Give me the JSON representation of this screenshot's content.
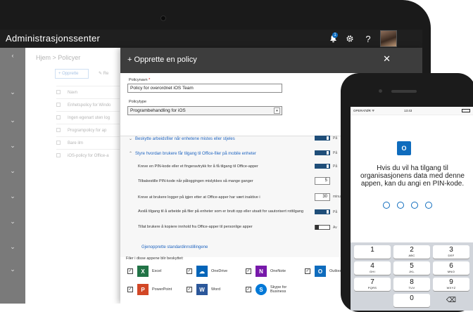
{
  "topbar": {
    "title": "Administrasjonssenter",
    "notification_count": "1",
    "icons": [
      "bell-icon",
      "gear-icon",
      "help-icon"
    ],
    "help_label": "?"
  },
  "background_page": {
    "breadcrumb": "Hjem > Policyer",
    "new_button": "+ Opprette",
    "edit_button": "✎ Re",
    "column_header": "Navn",
    "rows": [
      "Enhetspolicy for Windo",
      "Ingen egenart uten log",
      "Programpolicy for ap",
      "Bare ilm",
      "iOS-policy for Office-a"
    ]
  },
  "panel": {
    "title": "+ Opprette en policy",
    "close_label": "✕",
    "name_label": "Policynavn",
    "name_required": "*",
    "name_value": "Policy for overordnet iOS Team",
    "type_label": "Policytype",
    "type_value": "Programbehandling for iOS",
    "sections": [
      {
        "label": "Beskytte arbeidsfiler når enhetene mistes eller stjeles",
        "chevron": "⌄",
        "toggle_label": "På"
      },
      {
        "label": "Styre hvordan brukere får tilgang til Office-filer på mobile enheter",
        "chevron": "⌃",
        "toggle_label": "På"
      }
    ],
    "settings": [
      {
        "text": "Kreve en PIN-kode eller et fingeravtrykk for å få tilgang til Office-apper",
        "control": "toggle",
        "value": "På"
      },
      {
        "text": "Tilbakestille PIN-kode når påloggingen mislykkes så mange ganger",
        "control": "number",
        "value": "5"
      },
      {
        "text": "Kreve at brukere logger på igjen etter at Office-apper har vært inaktive i",
        "control": "number",
        "value": "30",
        "unit": "minut"
      },
      {
        "text": "Avslå tilgang til å arbeide på filer på enheter som er brutt opp eller utsatt for uautorisert rottilgang",
        "control": "toggle",
        "value": "På"
      },
      {
        "text": "Tillat brukere å kopiere innhold fra Office-apper til personlige apper",
        "control": "toggle-off",
        "value": "Av"
      }
    ],
    "restore_link": "Gjenopprette standardinnstillingene",
    "files_label": "Filer i disse appene blir beskyttet:",
    "apps": [
      {
        "name": "Excel",
        "letter": "X",
        "color": "#217346",
        "icon": "excel-icon"
      },
      {
        "name": "OneDrive",
        "letter": "☁",
        "color": "#0364b8",
        "icon": "onedrive-icon"
      },
      {
        "name": "OneNote",
        "letter": "N",
        "color": "#7719aa",
        "icon": "onenote-icon"
      },
      {
        "name": "Outlook",
        "letter": "O",
        "color": "#0f6cbd",
        "icon": "outlook-icon"
      },
      {
        "name": "PowerPoint",
        "letter": "P",
        "color": "#d24726",
        "icon": "powerpoint-icon"
      },
      {
        "name": "Word",
        "letter": "W",
        "color": "#2b579a",
        "icon": "word-icon"
      },
      {
        "name": "Skype for Business",
        "letter": "S",
        "color": "#0078d7",
        "icon": "skype-icon"
      }
    ],
    "check_mark": "✓"
  },
  "phone": {
    "carrier": "OPERATØR ᯤ",
    "time": "13:43",
    "outlook_letter": "O",
    "message": "Hvis du vil ha tilgang til organisasjonens data med denne appen, kan du angi en PIN-kode.",
    "pin_length": 4,
    "keys": [
      {
        "d": "1",
        "l": ""
      },
      {
        "d": "2",
        "l": "ABC"
      },
      {
        "d": "3",
        "l": "DEF"
      },
      {
        "d": "4",
        "l": "GHI"
      },
      {
        "d": "5",
        "l": "JKL"
      },
      {
        "d": "6",
        "l": "MNO"
      },
      {
        "d": "7",
        "l": "PQRS"
      },
      {
        "d": "8",
        "l": "TUV"
      },
      {
        "d": "9",
        "l": "WXYZ"
      },
      {
        "d": "",
        "l": ""
      },
      {
        "d": "0",
        "l": ""
      },
      {
        "d": "⌫",
        "l": ""
      }
    ]
  }
}
